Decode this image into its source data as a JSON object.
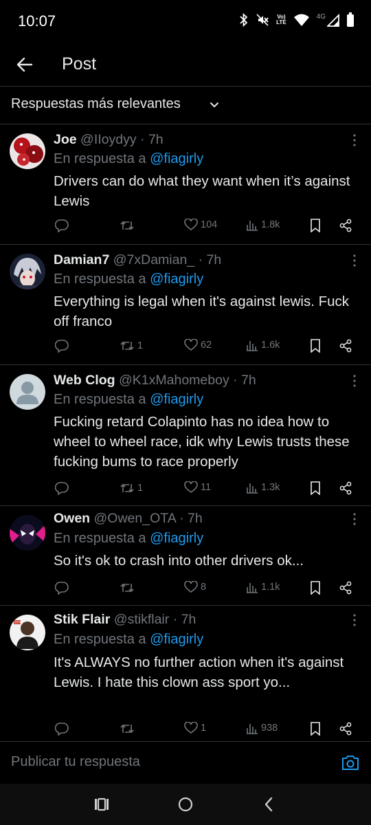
{
  "status": {
    "time": "10:07",
    "volte": "Vo)\nLTE",
    "network": "4G"
  },
  "header": {
    "title": "Post",
    "back_icon": "arrow-left-icon"
  },
  "sort": {
    "label": "Respuestas más relevantes"
  },
  "replies": [
    {
      "name": "Joe",
      "handle": "@IIoydyy",
      "time": "· 7h",
      "in_reply_prefix": "En respuesta a ",
      "in_reply_to": "@fiagirly",
      "text": "Drivers can do what they want when it’s against Lewis",
      "retweets": "",
      "likes": "104",
      "views": "1.8k"
    },
    {
      "name": "Damian7",
      "handle": "@7xDamian_",
      "time": "· 7h",
      "in_reply_prefix": "En respuesta a ",
      "in_reply_to": "@fiagirly",
      "text": "Everything is legal when it's against lewis. Fuck off franco",
      "retweets": "1",
      "likes": "62",
      "views": "1.6k"
    },
    {
      "name": "Web Clog",
      "handle": "@K1xMahomeboy",
      "time": "· 7h",
      "in_reply_prefix": "En respuesta a ",
      "in_reply_to": "@fiagirly",
      "text": "Fucking retard Colapinto has no idea how to wheel to wheel race, idk why Lewis trusts these fucking bums to race properly",
      "retweets": "1",
      "likes": "11",
      "views": "1.3k"
    },
    {
      "name": "Owen",
      "handle": "@Owen_OTA",
      "time": "· 7h",
      "in_reply_prefix": "En respuesta a ",
      "in_reply_to": "@fiagirly",
      "text": "So it's ok to crash into other drivers ok...",
      "retweets": "",
      "likes": "8",
      "views": "1.1k"
    },
    {
      "name": "Stik Flair",
      "handle": "@stikflair",
      "time": "· 7h",
      "in_reply_prefix": "En respuesta a ",
      "in_reply_to": "@fiagirly",
      "text": "It's ALWAYS no further action when it's against Lewis. I hate this clown ass sport yo...",
      "retweets": "",
      "likes": "1",
      "views": "938"
    }
  ],
  "compose": {
    "placeholder": "Publicar tu respuesta",
    "icon": "camera-icon"
  },
  "colors": {
    "background": "#000000",
    "accent": "#1d9bf0",
    "text_primary": "#e7e9ea",
    "text_secondary": "#71767b",
    "divider": "#2f3336"
  }
}
